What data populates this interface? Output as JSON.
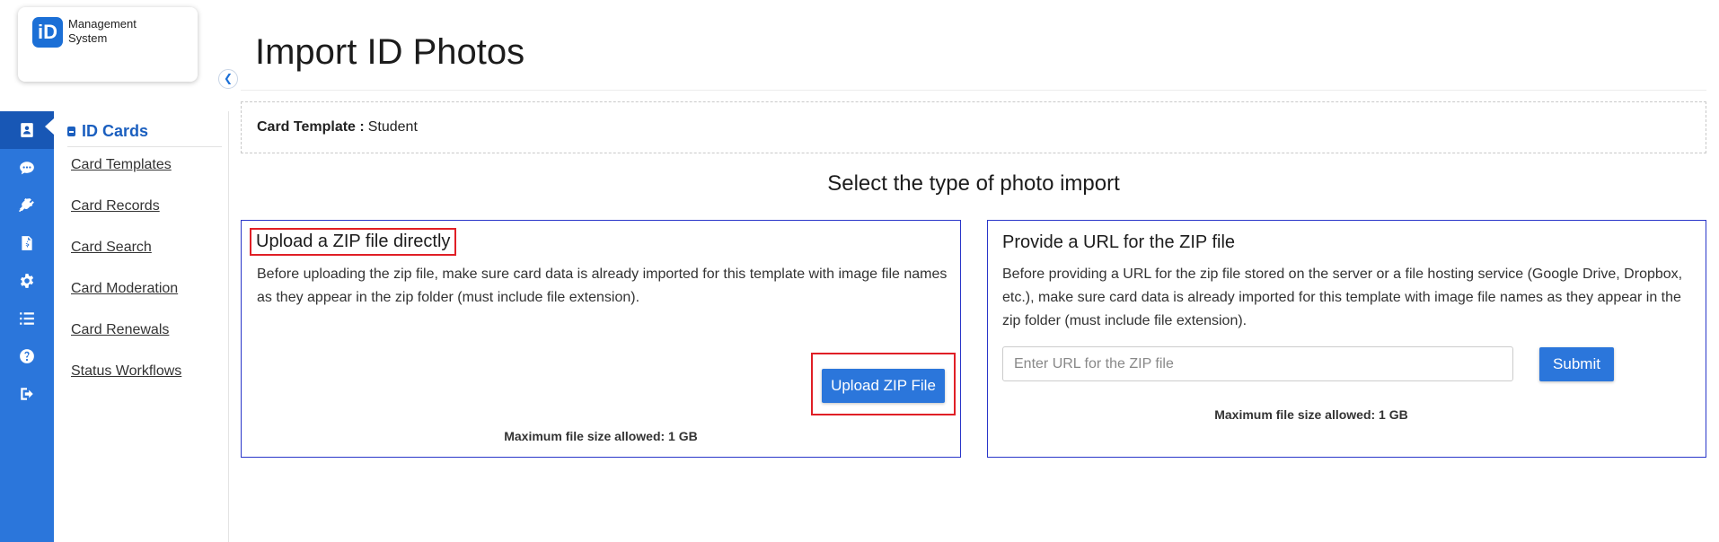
{
  "logo": {
    "mark": "iD",
    "line1": "Management",
    "line2": "System"
  },
  "sidebar": {
    "rail_icons": [
      "id-card-icon",
      "chat-icon",
      "plug-icon",
      "invoice-icon",
      "gear-icon",
      "list-icon",
      "help-icon",
      "logout-icon"
    ],
    "section_title": "ID Cards",
    "items": [
      {
        "label": "Card Templates"
      },
      {
        "label": "Card Records"
      },
      {
        "label": "Card Search"
      },
      {
        "label": "Card Moderation"
      },
      {
        "label": "Card Renewals"
      },
      {
        "label": "Status Workflows"
      }
    ]
  },
  "page": {
    "title": "Import ID Photos",
    "template_label": "Card Template :",
    "template_value": "Student",
    "section_heading": "Select the type of photo import"
  },
  "upload_panel": {
    "title": "Upload a ZIP file directly",
    "description": "Before uploading the zip file, make sure card data is already imported for this template with image file names as they appear in the zip folder (must include file extension).",
    "button_label": "Upload ZIP File",
    "max_size": "Maximum file size allowed: 1 GB"
  },
  "url_panel": {
    "title": "Provide a URL for the ZIP file",
    "description": "Before providing a URL for the zip file stored on the server or a file hosting service (Google Drive, Dropbox, etc.), make sure card data is already imported for this template with image file names as they appear in the zip folder (must include file extension).",
    "input_placeholder": "Enter URL for the ZIP file",
    "input_value": "",
    "submit_label": "Submit",
    "max_size": "Maximum file size allowed: 1 GB"
  },
  "colors": {
    "primary": "#2b76db",
    "rail_active": "#1857b5",
    "panel_border": "#2a36c9",
    "highlight": "#e01f26"
  }
}
